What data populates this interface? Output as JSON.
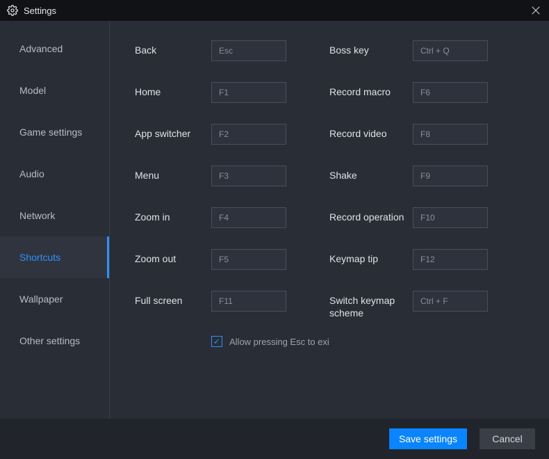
{
  "window": {
    "title": "Settings"
  },
  "sidebar": {
    "items": [
      {
        "label": "Advanced"
      },
      {
        "label": "Model"
      },
      {
        "label": "Game settings"
      },
      {
        "label": "Audio"
      },
      {
        "label": "Network"
      },
      {
        "label": "Shortcuts"
      },
      {
        "label": "Wallpaper"
      },
      {
        "label": "Other settings"
      }
    ],
    "active_index": 5
  },
  "shortcuts": {
    "left": [
      {
        "label": "Back",
        "value": "Esc"
      },
      {
        "label": "Home",
        "value": "F1"
      },
      {
        "label": "App switcher",
        "value": "F2"
      },
      {
        "label": "Menu",
        "value": "F3"
      },
      {
        "label": "Zoom in",
        "value": "F4"
      },
      {
        "label": "Zoom out",
        "value": "F5"
      },
      {
        "label": "Full screen",
        "value": "F11"
      }
    ],
    "right": [
      {
        "label": "Boss key",
        "value": "Ctrl + Q"
      },
      {
        "label": "Record macro",
        "value": "F6"
      },
      {
        "label": "Record video",
        "value": "F8"
      },
      {
        "label": "Shake",
        "value": "F9"
      },
      {
        "label": "Record operation",
        "value": "F10"
      },
      {
        "label": "Keymap tip",
        "value": "F12"
      },
      {
        "label": "Switch keymap scheme",
        "value": "Ctrl + F"
      }
    ],
    "allow_esc_label": "Allow pressing Esc to exi",
    "allow_esc_checked": true
  },
  "footer": {
    "save_label": "Save settings",
    "cancel_label": "Cancel"
  }
}
